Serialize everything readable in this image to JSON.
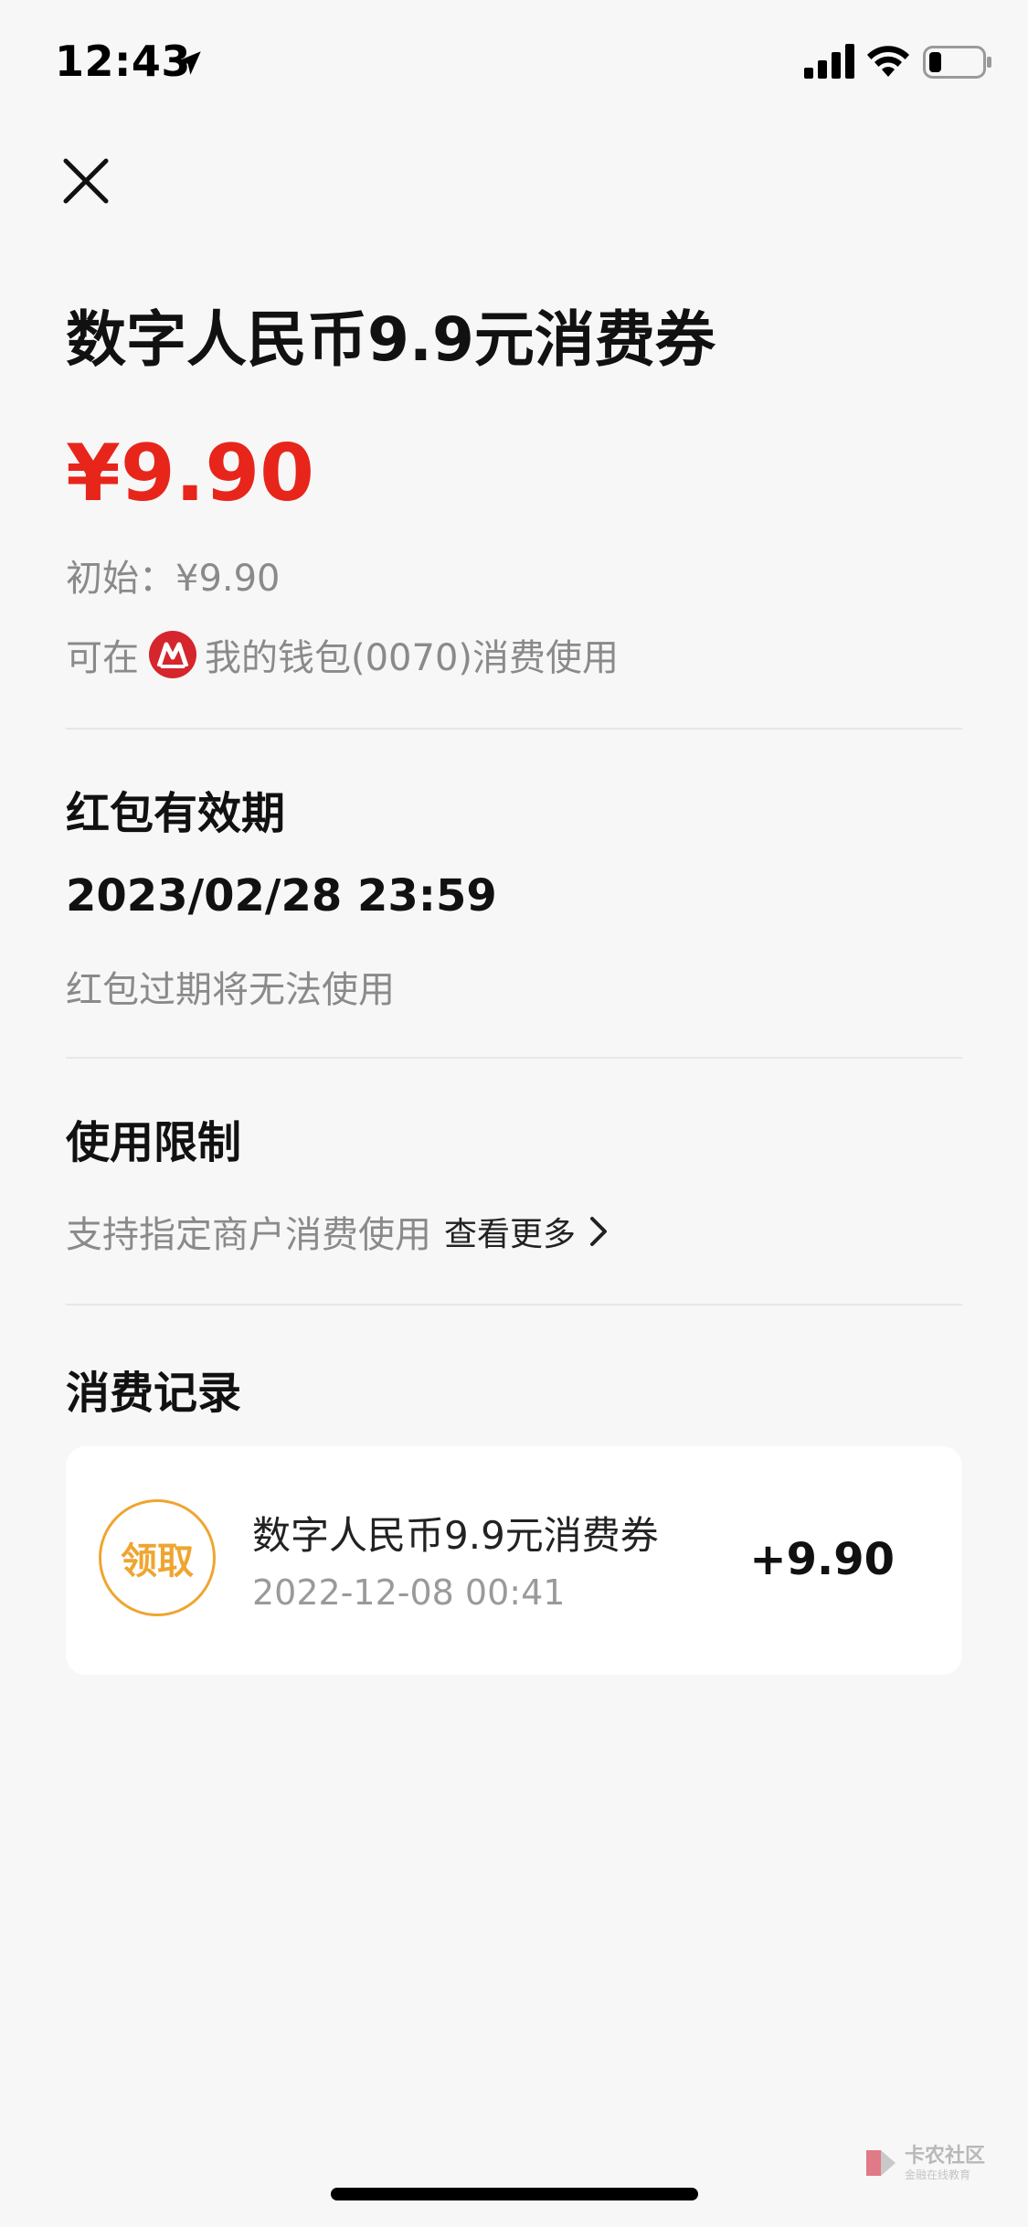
{
  "status_bar": {
    "time": "12:43",
    "icons": [
      "location-arrow-icon",
      "cellular-signal-icon",
      "wifi-icon",
      "battery-icon"
    ]
  },
  "header": {
    "close_icon": "close-icon",
    "title": "数字人民币9.9元消费券"
  },
  "voucher": {
    "amount": "¥9.90",
    "initial": "初始：¥9.90",
    "usable_prefix": "可在",
    "usable_wallet": "我的钱包(0070)消费使用",
    "bank_logo_icon": "bank-logo-icon"
  },
  "validity": {
    "title": "红包有效期",
    "date": "2023/02/28 23:59",
    "note": "红包过期将无法使用"
  },
  "limits": {
    "title": "使用限制",
    "text": "支持指定商户消费使用",
    "see_more": "查看更多",
    "chevron_icon": "chevron-right-icon"
  },
  "records": {
    "title": "消费记录",
    "items": [
      {
        "badge": "领取",
        "title": "数字人民币9.9元消费券",
        "time": "2022-12-08 00:41",
        "amount": "+9.90"
      }
    ]
  },
  "watermark": {
    "main": "卡农社区",
    "sub": "金融在线教育"
  },
  "colors": {
    "background": "#f7f7f7",
    "amount_red": "#e8251a",
    "badge_orange": "#efa530",
    "muted_gray": "#8a8a8a",
    "card_white": "#ffffff",
    "divider": "#e7e7e7",
    "bank_logo_red": "#d4262c"
  }
}
